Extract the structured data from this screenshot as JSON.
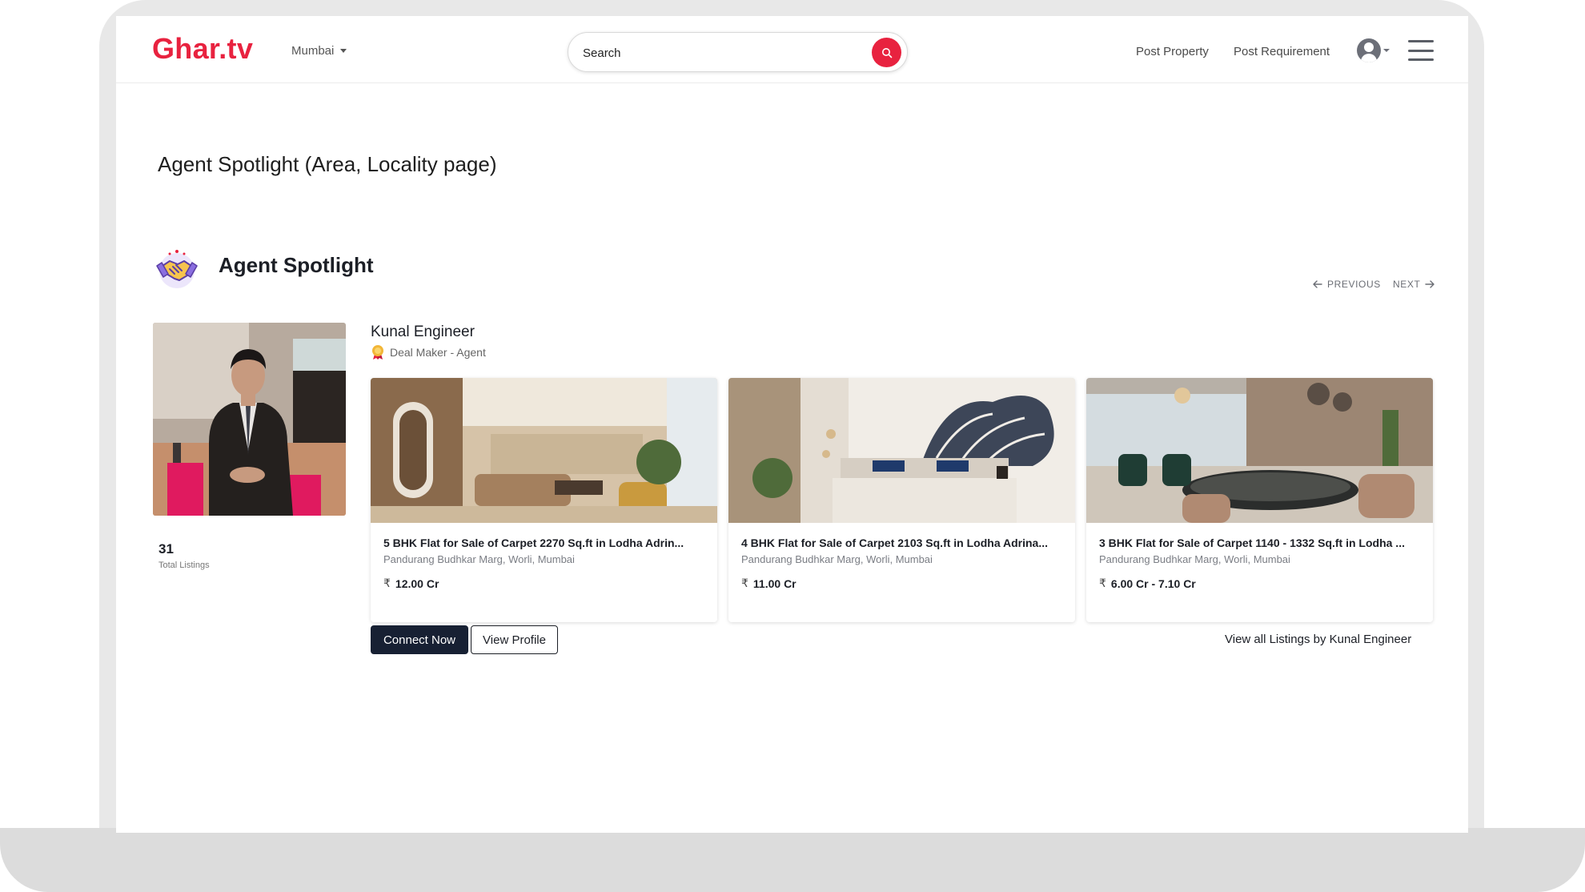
{
  "header": {
    "logo": "Ghar.tv",
    "city": "Mumbai",
    "search_placeholder": "Search",
    "nav": [
      "Post Property",
      "Post Requirement"
    ]
  },
  "page_title": "Agent Spotlight (Area, Locality page)",
  "section": {
    "title": "Agent Spotlight",
    "pager": {
      "previous": "PREVIOUS",
      "next": "NEXT"
    }
  },
  "agent": {
    "name": "Kunal Engineer",
    "role": "Deal Maker - Agent",
    "total_listings": "31",
    "total_listings_label": "Total Listings"
  },
  "listings": [
    {
      "title": "5 BHK Flat for Sale of Carpet 2270 Sq.ft in Lodha Adrin...",
      "location": "Pandurang Budhkar Marg, Worli, Mumbai",
      "price": "12.00 Cr"
    },
    {
      "title": "4 BHK Flat for Sale of Carpet 2103 Sq.ft in Lodha Adrina...",
      "location": "Pandurang Budhkar Marg, Worli, Mumbai",
      "price": "11.00 Cr"
    },
    {
      "title": "3 BHK Flat for Sale of Carpet 1140 - 1332 Sq.ft in Lodha ...",
      "location": "Pandurang Budhkar Marg, Worli, Mumbai",
      "price": "6.00 Cr - 7.10 Cr"
    }
  ],
  "currency_symbol": "₹",
  "actions": {
    "connect": "Connect Now",
    "profile": "View Profile",
    "view_all": "View all Listings by Kunal Engineer"
  },
  "colors": {
    "brand": "#e8223f",
    "dark_button": "#172033"
  },
  "icons": [
    "search-icon",
    "user-avatar-icon",
    "menu-icon",
    "handshake-icon",
    "badge-icon",
    "arrow-left-icon",
    "arrow-right-icon",
    "rupee-icon"
  ]
}
